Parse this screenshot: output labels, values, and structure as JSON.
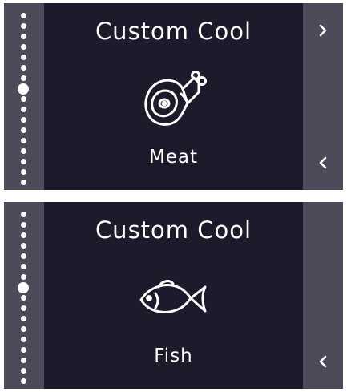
{
  "screens": [
    {
      "title": "Custom Cool",
      "item_label": "Meat",
      "item_icon": "meat-icon",
      "page_count": 17,
      "active_page": 7,
      "show_next": true,
      "show_prev": true
    },
    {
      "title": "Custom Cool",
      "item_label": "Fish",
      "item_icon": "fish-icon",
      "page_count": 17,
      "active_page": 7,
      "show_next": false,
      "show_prev": true
    }
  ],
  "nav_icons": {
    "next": "chevron-right-icon",
    "prev": "chevron-left-icon"
  },
  "colors": {
    "background": "#1b1b2b",
    "rail": "#4b4b5a",
    "foreground": "#ffffff"
  }
}
